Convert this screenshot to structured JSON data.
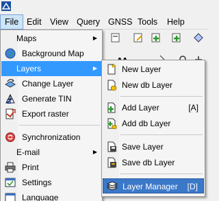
{
  "menubar": {
    "items": [
      "File",
      "Edit",
      "View",
      "Query",
      "GNSS",
      "Tools",
      "Help"
    ]
  },
  "file_menu": {
    "items": [
      {
        "label": "Maps",
        "icon": "none",
        "submenu": true
      },
      {
        "label": "Background Map",
        "icon": "globe-icon"
      },
      {
        "label": "Layers",
        "icon": "none",
        "submenu": true
      },
      {
        "label": "Change Layer",
        "icon": "change-layer-icon"
      },
      {
        "label": "Generate TIN",
        "icon": "tin-icon"
      },
      {
        "label": "Export raster",
        "icon": "export-raster-icon"
      },
      {
        "label": "Synchronization",
        "icon": "sync-icon"
      },
      {
        "label": "E-mail",
        "icon": "none",
        "submenu": true
      },
      {
        "label": "Print",
        "icon": "printer-icon"
      },
      {
        "label": "Settings",
        "icon": "settings-icon"
      },
      {
        "label": "Language",
        "icon": "language-icon"
      }
    ]
  },
  "layers_menu": {
    "items": [
      {
        "label": "New Layer",
        "icon": "new-layer-icon"
      },
      {
        "label": "New db Layer",
        "icon": "new-db-layer-icon"
      },
      {
        "label": "Add Layer",
        "icon": "add-layer-icon",
        "shortcut": "[A]"
      },
      {
        "label": "Add db Layer",
        "icon": "add-db-layer-icon"
      },
      {
        "label": "Save Layer",
        "icon": "save-layer-icon"
      },
      {
        "label": "Save db Layer",
        "icon": "save-db-layer-icon"
      },
      {
        "label": "Layer Manager",
        "icon": "layer-manager-icon",
        "shortcut": "[D]"
      }
    ]
  },
  "colors": {
    "highlight": "#3399ff",
    "menubar_active": "#cce4f7"
  }
}
